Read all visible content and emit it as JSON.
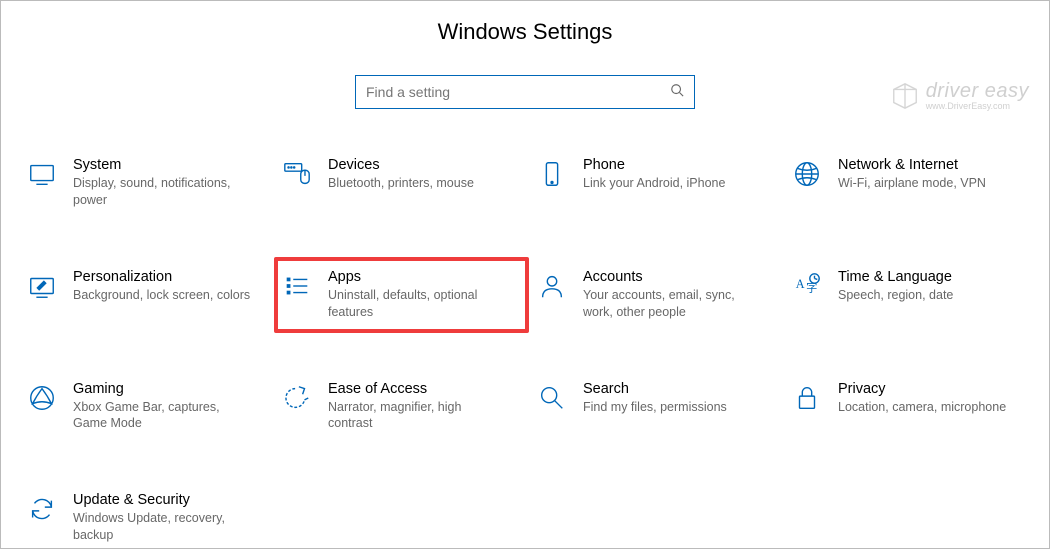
{
  "header": {
    "title": "Windows Settings"
  },
  "search": {
    "placeholder": "Find a setting"
  },
  "watermark": {
    "main": "driver easy",
    "sub": "www.DriverEasy.com"
  },
  "items": [
    {
      "label": "System",
      "desc": "Display, sound, notifications, power"
    },
    {
      "label": "Devices",
      "desc": "Bluetooth, printers, mouse"
    },
    {
      "label": "Phone",
      "desc": "Link your Android, iPhone"
    },
    {
      "label": "Network & Internet",
      "desc": "Wi-Fi, airplane mode, VPN"
    },
    {
      "label": "Personalization",
      "desc": "Background, lock screen, colors"
    },
    {
      "label": "Apps",
      "desc": "Uninstall, defaults, optional features"
    },
    {
      "label": "Accounts",
      "desc": "Your accounts, email, sync, work, other people"
    },
    {
      "label": "Time & Language",
      "desc": "Speech, region, date"
    },
    {
      "label": "Gaming",
      "desc": "Xbox Game Bar, captures, Game Mode"
    },
    {
      "label": "Ease of Access",
      "desc": "Narrator, magnifier, high contrast"
    },
    {
      "label": "Search",
      "desc": "Find my files, permissions"
    },
    {
      "label": "Privacy",
      "desc": "Location, camera, microphone"
    },
    {
      "label": "Update & Security",
      "desc": "Windows Update, recovery, backup"
    }
  ]
}
